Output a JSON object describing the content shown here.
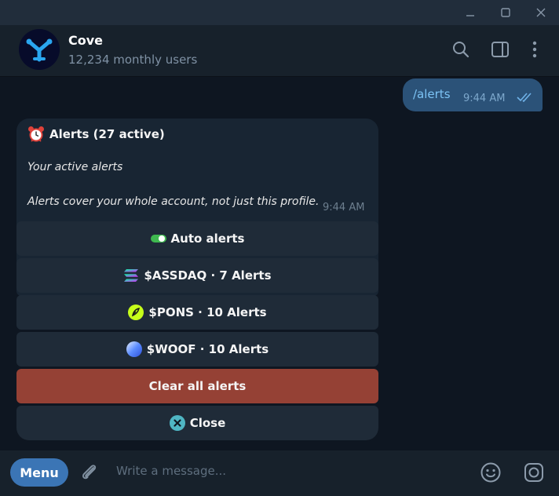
{
  "chat": {
    "title": "Cove",
    "subtitle": "12,234 monthly users"
  },
  "outgoing": {
    "text": "/alerts",
    "time": "9:44 AM"
  },
  "incoming": {
    "title": "Alerts (27 active)",
    "line1": "Your active alerts",
    "line2": "Alerts cover your whole account, not just this profile.",
    "time": "9:44 AM"
  },
  "buttons": {
    "auto": "Auto alerts",
    "assdaq": "$ASSDAQ · 7 Alerts",
    "pons": "$PONS · 10 Alerts",
    "woof": "$WOOF · 10 Alerts",
    "clear": "Clear all alerts",
    "close": "Close"
  },
  "composer": {
    "menu_label": "Menu",
    "placeholder": "Write a message..."
  },
  "colors": {
    "background": "#0e1621",
    "header": "#17212b",
    "outgoing_bubble": "#2b5278",
    "incoming_bubble": "#182533",
    "keyboard_button": "#1f2b38",
    "danger_button": "#954135",
    "menu_button": "#3b75b5"
  },
  "icons": [
    "minimize-icon",
    "maximize-icon",
    "close-window-icon",
    "search-icon",
    "sidebar-icon",
    "more-icon",
    "alarm-clock-icon",
    "toggle-icon",
    "solana-icon",
    "pons-icon",
    "woof-icon",
    "close-circle-icon",
    "attach-icon",
    "emoji-icon",
    "camera-icon"
  ]
}
